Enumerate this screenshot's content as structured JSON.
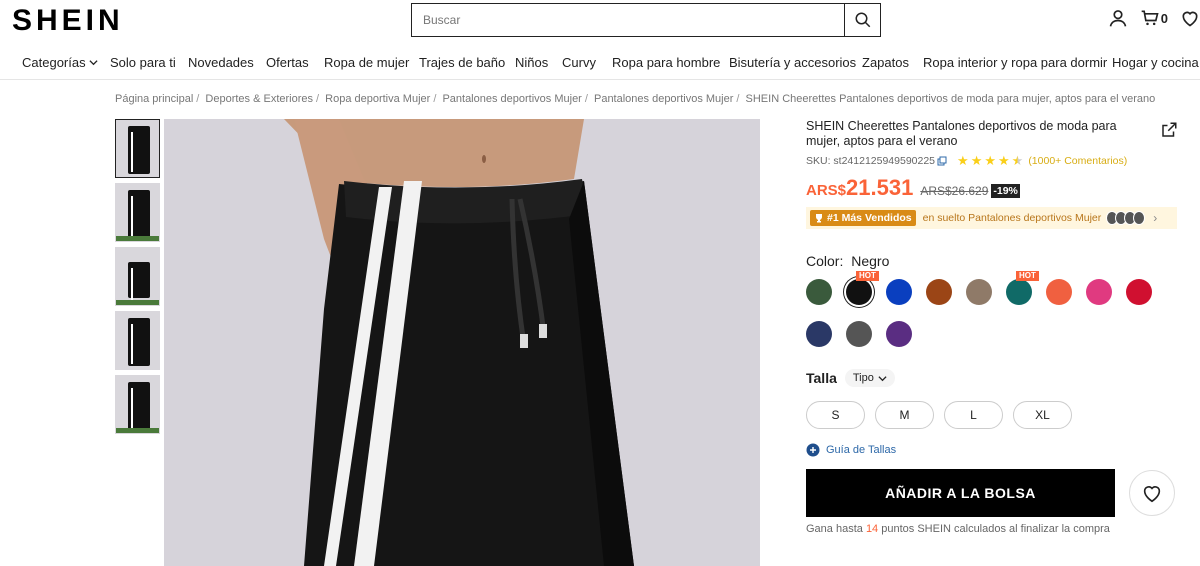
{
  "header": {
    "logo": "SHEIN",
    "search_placeholder": "Buscar",
    "cart_count": "0"
  },
  "nav": [
    "Categorías",
    "Solo para ti",
    "Novedades",
    "Ofertas",
    "Ropa de mujer",
    "Trajes de baño",
    "Niños",
    "Curvy",
    "Ropa para hombre",
    "Bisutería y accesorios",
    "Zapatos",
    "Ropa interior y ropa para dormir",
    "Hogar y cocina"
  ],
  "breadcrumb": [
    "Página principal",
    "Deportes & Exteriores",
    "Ropa deportiva Mujer",
    "Pantalones deportivos Mujer",
    "Pantalones deportivos Mujer",
    "SHEIN Cheerettes Pantalones deportivos de moda para mujer, aptos para el verano"
  ],
  "product": {
    "title": "SHEIN Cheerettes Pantalones deportivos de moda para mujer, aptos para el verano",
    "sku": "SKU: st2412125949590225",
    "rating": 4.5,
    "reviews": "(1000+ Comentarios)",
    "price_currency": "ARS$",
    "price_value": "21.531",
    "price_old": "ARS$26.629",
    "discount": "-19%",
    "best_badge": "#1 Más Vendidos",
    "best_text": "en suelto Pantalones deportivos Mujer",
    "color_label": "Color:",
    "color_value": "Negro",
    "size_label": "Talla",
    "size_type": "Tipo",
    "sizes": [
      "S",
      "M",
      "L",
      "XL"
    ],
    "size_guide": "Guía de Tallas",
    "add_to_bag": "AÑADIR A LA BOLSA",
    "points_prefix": "Gana hasta",
    "points_num": "14",
    "points_suffix": "puntos SHEIN calculados al finalizar la compra"
  },
  "swatches": [
    {
      "name": "green",
      "color": "#3a5a3c",
      "hot": false
    },
    {
      "name": "black",
      "color": "#111111",
      "hot": true,
      "selected": true
    },
    {
      "name": "blue",
      "color": "#0a3fbf",
      "hot": false
    },
    {
      "name": "brown",
      "color": "#9b4516",
      "hot": false
    },
    {
      "name": "taupe",
      "color": "#8f7a68",
      "hot": false
    },
    {
      "name": "teal",
      "color": "#106a67",
      "hot": true
    },
    {
      "name": "orange",
      "color": "#f06040",
      "hot": false
    },
    {
      "name": "pink",
      "color": "#e03a80",
      "hot": false
    },
    {
      "name": "red",
      "color": "#d01030",
      "hot": false
    },
    {
      "name": "navy",
      "color": "#2a3866",
      "hot": false
    },
    {
      "name": "gray",
      "color": "#555555",
      "hot": false
    },
    {
      "name": "purple",
      "color": "#5a2d82",
      "hot": false
    }
  ],
  "hot_label": "HOT",
  "thumbnails": 5
}
